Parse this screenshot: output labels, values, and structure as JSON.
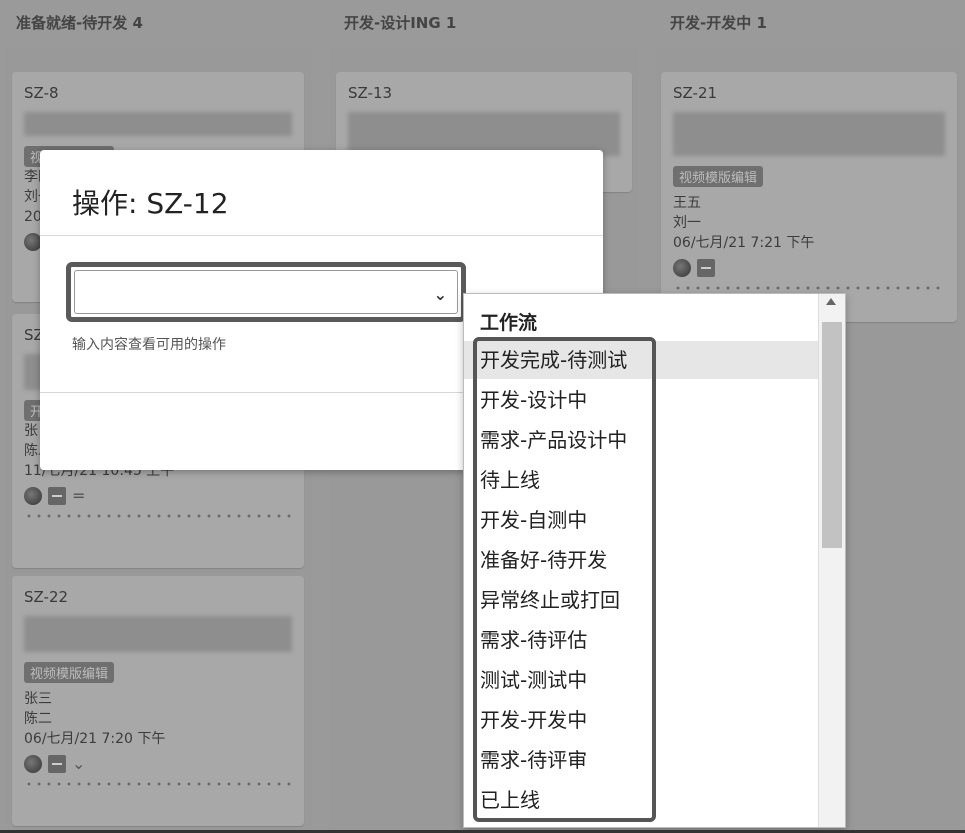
{
  "columns": [
    {
      "title": "准备就绪-待开发 4"
    },
    {
      "title": "开发-设计ING 1"
    },
    {
      "title": "开发-开发中 1"
    }
  ],
  "cards": {
    "sz8": {
      "key": "SZ-8",
      "tag": "视频模版编辑",
      "lines": [
        "李四",
        "刘一",
        "20"
      ]
    },
    "sz13": {
      "key": "SZ-13"
    },
    "sz21": {
      "key": "SZ-21",
      "tag": "视频模版编辑",
      "assignee": "王五",
      "reporter": "刘一",
      "date": "06/七月/21 7:21 下午"
    },
    "szmid": {
      "key": "SZ",
      "tag": "开",
      "assignee": "张",
      "reporter": "陈二",
      "date": "11/七月/21 10:45 上午",
      "priority": "="
    },
    "sz22": {
      "key": "SZ-22",
      "tag": "视频模版编辑",
      "assignee": "张三",
      "reporter": "陈二",
      "date": "06/七月/21 7:20 下午",
      "priority": "⌄"
    }
  },
  "modal": {
    "title": "操作: SZ-12",
    "select_value": "",
    "hint": "输入内容查看可用的操作"
  },
  "dropdown": {
    "group_title": "工作流",
    "options": [
      "开发完成-待测试",
      "开发-设计中",
      "需求-产品设计中",
      "待上线",
      "开发-自测中",
      "准备好-待开发",
      "异常终止或打回",
      "需求-待评估",
      "测试-测试中",
      "开发-开发中",
      "需求-待评审",
      "已上线"
    ]
  }
}
